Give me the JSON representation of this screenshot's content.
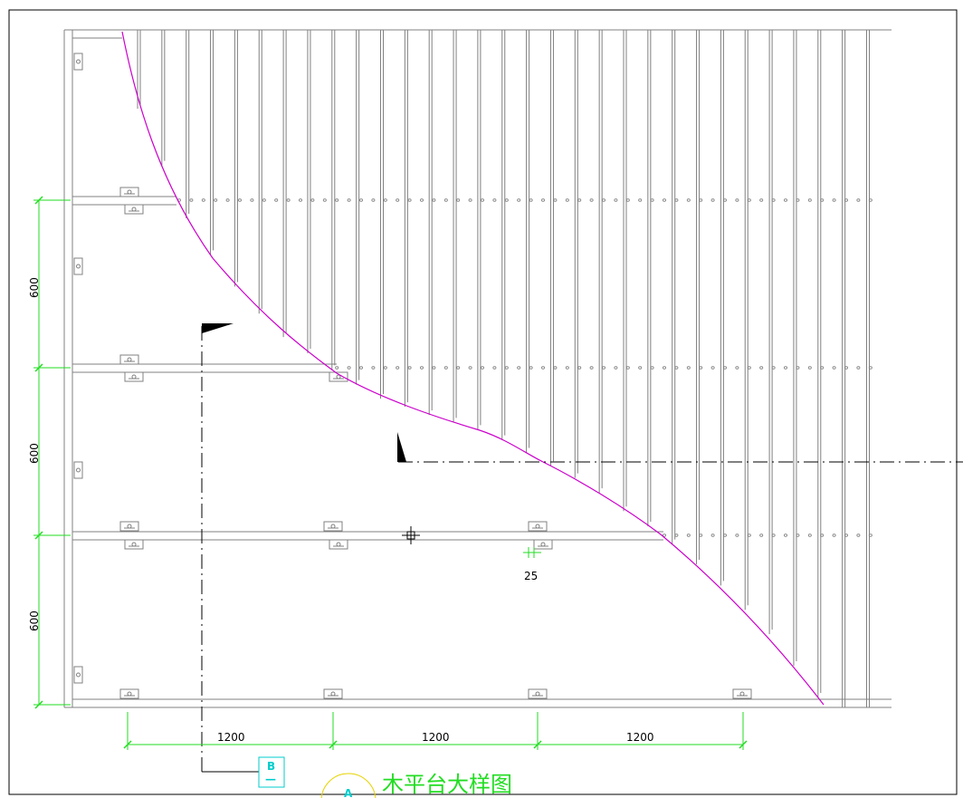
{
  "drawing": {
    "title": "木平台大样图",
    "section_tag": {
      "letter": "B",
      "sub": "—"
    },
    "circle_tag": "A",
    "horizontal_dims": [
      "1200",
      "1200",
      "1200"
    ],
    "vertical_dims": [
      "600",
      "600",
      "600"
    ],
    "small_dim": "25",
    "colors": {
      "background": "#ffffff",
      "line": "#808080",
      "frame": "#000000",
      "dimension": "#22dd22",
      "curve": "#cc00cc",
      "tag": "#00cccc",
      "circle": "#e6d200"
    }
  }
}
